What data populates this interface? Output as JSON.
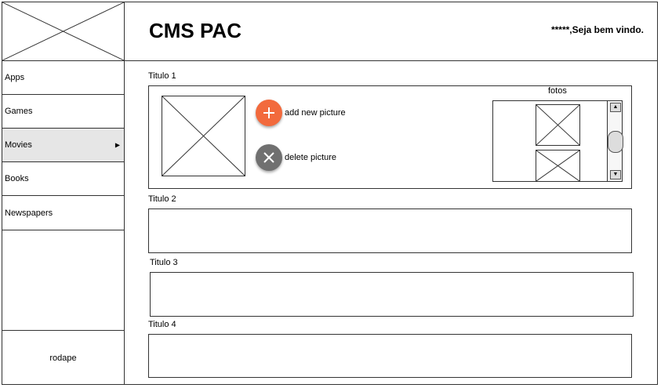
{
  "header": {
    "title": "CMS PAC",
    "welcome": "*****,Seja bem vindo."
  },
  "sidebar": {
    "items": [
      {
        "label": "Apps"
      },
      {
        "label": "Games"
      },
      {
        "label": "Movies",
        "active": true,
        "icon": "chevron-right-icon"
      },
      {
        "label": "Books"
      },
      {
        "label": "Newspapers"
      }
    ],
    "footer": "rodape"
  },
  "main": {
    "section1": {
      "label": "Titulo 1",
      "add_label": "add new picture",
      "delete_label": "delete picture",
      "photos_label": "fotos",
      "add_color": "#f26a3d",
      "delete_color": "#707070"
    },
    "section2": {
      "label": "Titulo 2"
    },
    "section3": {
      "label": "Titulo 3"
    },
    "section4": {
      "label": "Titulo 4"
    }
  }
}
